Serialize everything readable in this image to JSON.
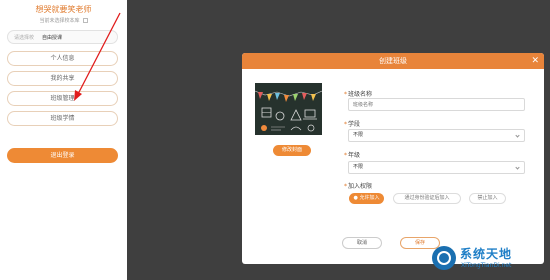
{
  "sidebar": {
    "teacher_name": "想哭就要笑老师",
    "subtitle": "当前未选择校本库",
    "school_label": "请选择校",
    "school_value": "自由授课",
    "menu": [
      "个人信息",
      "我的共享",
      "班级管理",
      "班级学情"
    ],
    "logout": "退出登录"
  },
  "dialog": {
    "title": "创建班级",
    "close_icon": "close-icon",
    "change_cover": "修改封面",
    "class_name_label": "班级名称",
    "class_name_placeholder": "班级名称",
    "stage_label": "学段",
    "stage_value": "不限",
    "grade_label": "年级",
    "grade_value": "不限",
    "perm_label": "加入权限",
    "perm_options": [
      "允许加入",
      "通过身份验证后加入",
      "禁止加入"
    ],
    "cancel": "取消",
    "save": "保存"
  },
  "colors": {
    "accent": "#ee8a35",
    "header": "#e8843a",
    "backdrop": "#3f3f3f"
  },
  "watermark": {
    "line1": "系统天地",
    "line2": "XiTongTianDi.net"
  }
}
